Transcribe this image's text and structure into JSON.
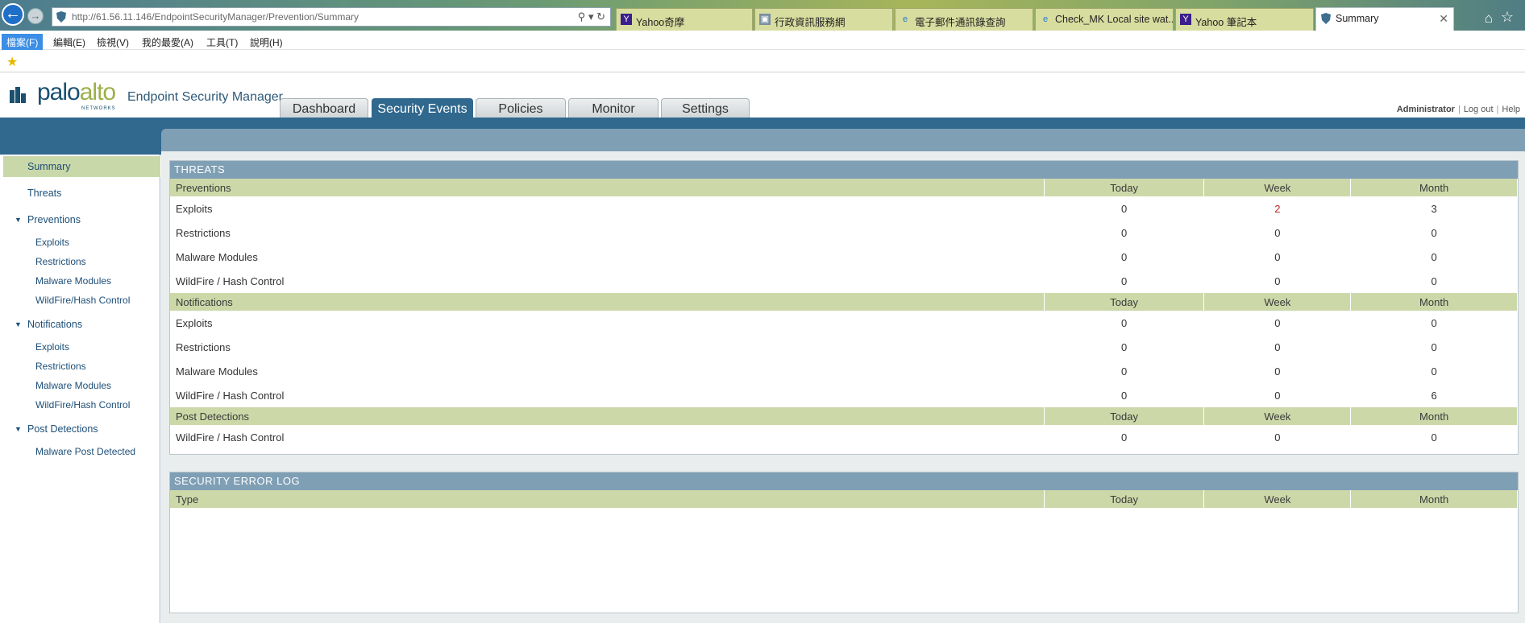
{
  "browser": {
    "url": "http://61.56.11.146/EndpointSecurityManager/Prevention/Summary",
    "tabs": [
      {
        "label": "Yahoo奇摩",
        "icon": "yahoo-icon"
      },
      {
        "label": "行政資訊服務網",
        "icon": "page-icon"
      },
      {
        "label": "電子郵件通訊錄查詢",
        "icon": "ie-icon"
      },
      {
        "label": "Check_MK Local site wat...",
        "icon": "ie-icon"
      },
      {
        "label": "Yahoo 筆記本",
        "icon": "yahoo-icon"
      },
      {
        "label": "Summary",
        "icon": "shield-icon",
        "active": true
      }
    ],
    "menu": [
      "檔案(F)",
      "編輯(E)",
      "檢視(V)",
      "我的最愛(A)",
      "工具(T)",
      "說明(H)"
    ]
  },
  "app": {
    "logo_main": "palo",
    "logo_accent": "alto",
    "logo_sub": "NETWORKS",
    "product": "Endpoint Security Manager",
    "tabs": [
      "Dashboard",
      "Security Events",
      "Policies",
      "Monitor",
      "Settings"
    ],
    "active_tab": "Security Events",
    "user": "Administrator",
    "logout": "Log out",
    "help": "Help"
  },
  "sidebar": {
    "summary": "Summary",
    "threats": "Threats",
    "preventions": "Preventions",
    "prev_items": [
      "Exploits",
      "Restrictions",
      "Malware Modules",
      "WildFire/Hash Control"
    ],
    "notifications": "Notifications",
    "notif_items": [
      "Exploits",
      "Restrictions",
      "Malware Modules",
      "WildFire/Hash Control"
    ],
    "post": "Post Detections",
    "post_items": [
      "Malware Post Detected"
    ]
  },
  "threats": {
    "title": "THREATS",
    "cols": [
      "Today",
      "Week",
      "Month"
    ],
    "preventions": {
      "label": "Preventions",
      "rows": [
        {
          "name": "Exploits",
          "today": "0",
          "week": "2",
          "month": "3"
        },
        {
          "name": "Restrictions",
          "today": "0",
          "week": "0",
          "month": "0"
        },
        {
          "name": "Malware Modules",
          "today": "0",
          "week": "0",
          "month": "0"
        },
        {
          "name": "WildFire / Hash Control",
          "today": "0",
          "week": "0",
          "month": "0"
        }
      ]
    },
    "notifications": {
      "label": "Notifications",
      "rows": [
        {
          "name": "Exploits",
          "today": "0",
          "week": "0",
          "month": "0"
        },
        {
          "name": "Restrictions",
          "today": "0",
          "week": "0",
          "month": "0"
        },
        {
          "name": "Malware Modules",
          "today": "0",
          "week": "0",
          "month": "0"
        },
        {
          "name": "WildFire / Hash Control",
          "today": "0",
          "week": "0",
          "month": "6"
        }
      ]
    },
    "post": {
      "label": "Post Detections",
      "rows": [
        {
          "name": "WildFire / Hash Control",
          "today": "0",
          "week": "0",
          "month": "0"
        }
      ]
    }
  },
  "error_log": {
    "title": "SECURITY ERROR LOG",
    "cols": [
      "Type",
      "Today",
      "Week",
      "Month"
    ]
  },
  "colors": {
    "highlight_value": "#c0282a",
    "accent_blue": "#30688e",
    "section_green": "#cdd8a9"
  }
}
